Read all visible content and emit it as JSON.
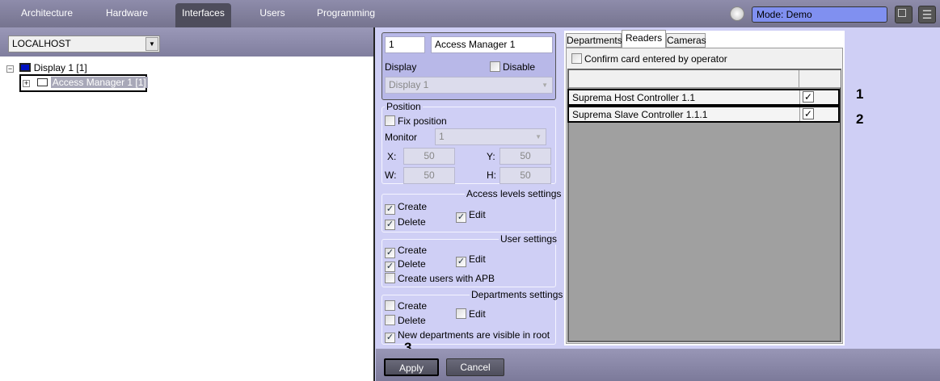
{
  "top_tabs": [
    "Architecture",
    "Hardware",
    "Interfaces",
    "Users",
    "Programming"
  ],
  "active_tab": "Interfaces",
  "mode": "Mode: Demo",
  "host": "LOCALHOST",
  "tree": {
    "root": "Display 1 [1]",
    "child": "Access Manager 1 [1]"
  },
  "props": {
    "id": "1",
    "name": "Access Manager 1",
    "display_label": "Display",
    "disable_label": "Disable",
    "display_value": "Display 1",
    "position": {
      "title": "Position",
      "fix": "Fix position",
      "monitor_label": "Monitor",
      "monitor": "1",
      "x_label": "X:",
      "x": "50",
      "y_label": "Y:",
      "y": "50",
      "w_label": "W:",
      "w": "50",
      "h_label": "H:",
      "h": "50"
    },
    "access_levels": {
      "title": "Access levels settings",
      "create": "Create",
      "delete": "Delete",
      "edit": "Edit"
    },
    "user": {
      "title": "User settings",
      "create": "Create",
      "delete": "Delete",
      "edit": "Edit",
      "apb": "Create users with APB"
    },
    "departments": {
      "title": "Departments settings",
      "create": "Create",
      "delete": "Delete",
      "edit": "Edit",
      "visible_root": "New departments are visible in root"
    }
  },
  "tabs": [
    "Departments",
    "Readers",
    "Cameras"
  ],
  "active_inner_tab": "Readers",
  "confirm_card": "Confirm card entered by operator",
  "readers": [
    {
      "name": "Suprema Host Controller 1.1",
      "checked": true,
      "annotation": "1"
    },
    {
      "name": "Suprema Slave Controller 1.1.1",
      "checked": true,
      "annotation": "2"
    }
  ],
  "buttons": {
    "apply": "Apply",
    "cancel": "Cancel",
    "apply_annotation": "3"
  },
  "check": "✓"
}
